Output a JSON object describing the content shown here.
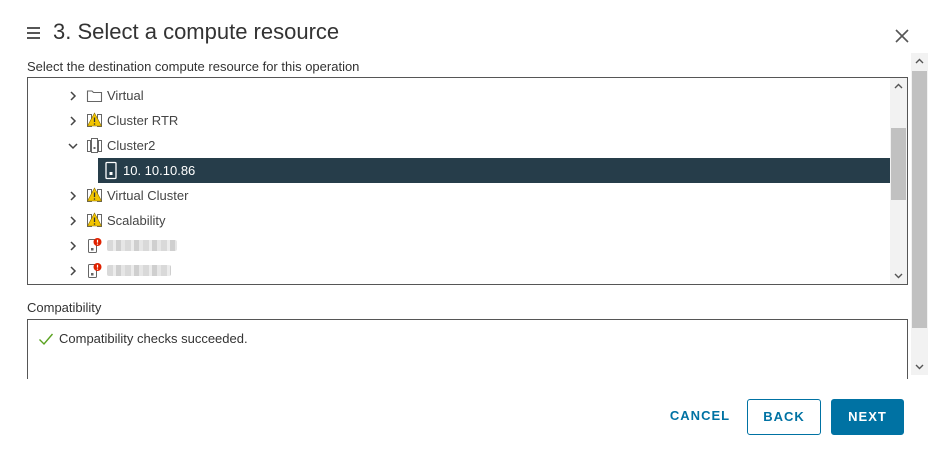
{
  "dialog": {
    "title": "3. Select a compute resource",
    "subtitle": "Select the destination compute resource for this operation"
  },
  "tree": {
    "items": [
      {
        "label": "Virtual",
        "icon": "folder-icon",
        "expanded": false
      },
      {
        "label": "Cluster RTR",
        "icon": "cluster-warning-icon",
        "expanded": false
      },
      {
        "label": "Cluster2",
        "icon": "cluster-icon",
        "expanded": true
      },
      {
        "label": "10. 10.10.86",
        "icon": "host-icon",
        "selected": true
      },
      {
        "label": "Virtual Cluster",
        "icon": "cluster-warning-icon",
        "expanded": false
      },
      {
        "label": "Scalability",
        "icon": "cluster-warning-icon",
        "expanded": false
      },
      {
        "label": "",
        "icon": "host-error-icon",
        "expanded": false,
        "redacted": true
      },
      {
        "label": "",
        "icon": "host-error-icon",
        "expanded": false,
        "redacted": true
      }
    ]
  },
  "compatibility": {
    "label": "Compatibility",
    "message": "Compatibility checks succeeded.",
    "icon": "check-icon"
  },
  "footer": {
    "cancel_label": "CANCEL",
    "back_label": "BACK",
    "next_label": "NEXT"
  },
  "colors": {
    "accent": "#0072a3",
    "selected_row": "#263d4a",
    "success": "#5aa220",
    "warning": "#f2c500",
    "error": "#e02200"
  }
}
